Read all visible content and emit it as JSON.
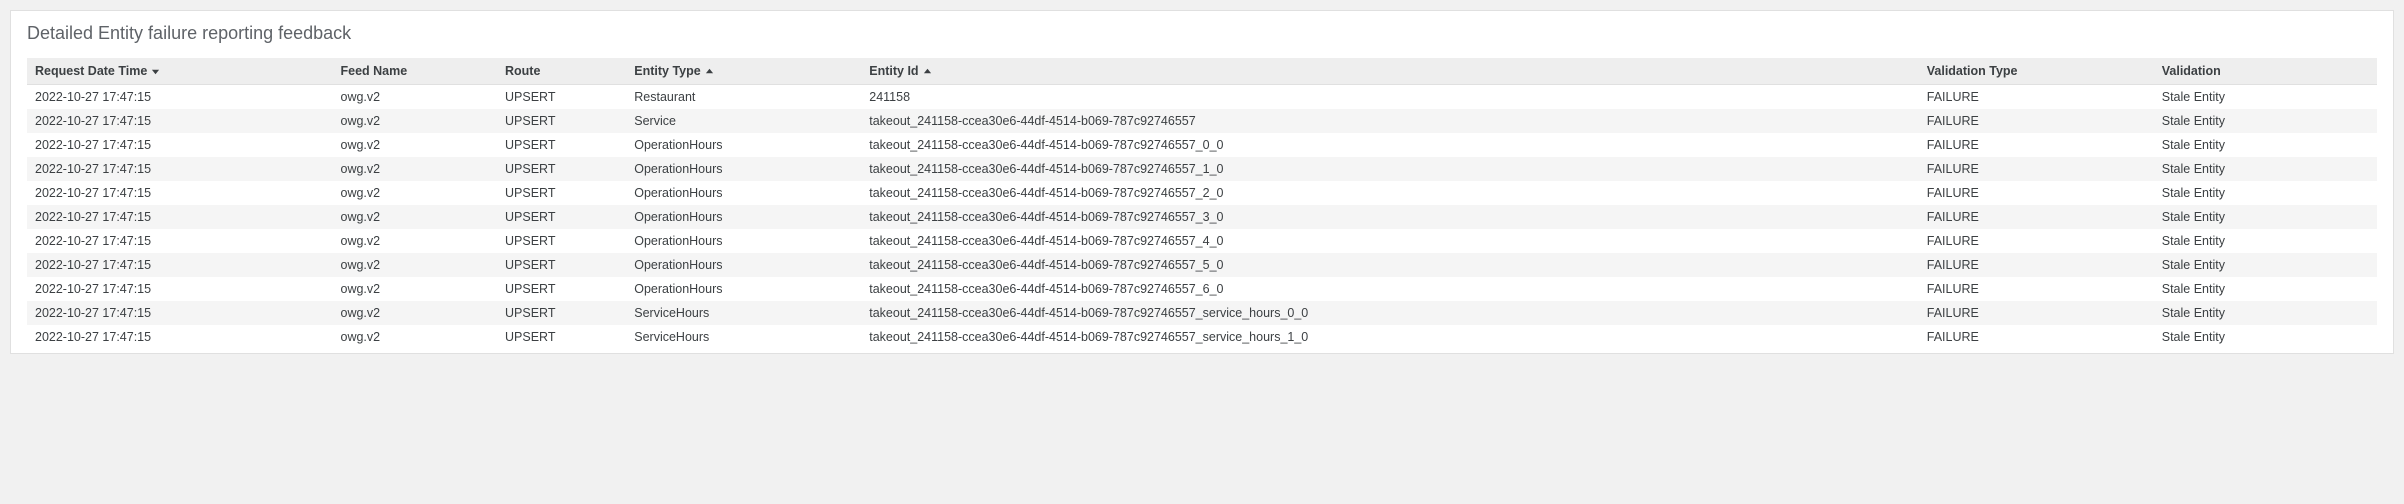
{
  "title": "Detailed Entity failure reporting feedback",
  "columns": {
    "request_date_time": "Request Date Time",
    "feed_name": "Feed Name",
    "route": "Route",
    "entity_type": "Entity Type",
    "entity_id": "Entity Id",
    "validation_type": "Validation Type",
    "validation": "Validation"
  },
  "sort": {
    "request_date_time": "desc",
    "entity_type": "asc",
    "entity_id": "asc"
  },
  "rows": [
    {
      "request_date_time": "2022-10-27 17:47:15",
      "feed_name": "owg.v2",
      "route": "UPSERT",
      "entity_type": "Restaurant",
      "entity_id": "241158",
      "validation_type": "FAILURE",
      "validation": "Stale Entity"
    },
    {
      "request_date_time": "2022-10-27 17:47:15",
      "feed_name": "owg.v2",
      "route": "UPSERT",
      "entity_type": "Service",
      "entity_id": "takeout_241158-ccea30e6-44df-4514-b069-787c92746557",
      "validation_type": "FAILURE",
      "validation": "Stale Entity"
    },
    {
      "request_date_time": "2022-10-27 17:47:15",
      "feed_name": "owg.v2",
      "route": "UPSERT",
      "entity_type": "OperationHours",
      "entity_id": "takeout_241158-ccea30e6-44df-4514-b069-787c92746557_0_0",
      "validation_type": "FAILURE",
      "validation": "Stale Entity"
    },
    {
      "request_date_time": "2022-10-27 17:47:15",
      "feed_name": "owg.v2",
      "route": "UPSERT",
      "entity_type": "OperationHours",
      "entity_id": "takeout_241158-ccea30e6-44df-4514-b069-787c92746557_1_0",
      "validation_type": "FAILURE",
      "validation": "Stale Entity"
    },
    {
      "request_date_time": "2022-10-27 17:47:15",
      "feed_name": "owg.v2",
      "route": "UPSERT",
      "entity_type": "OperationHours",
      "entity_id": "takeout_241158-ccea30e6-44df-4514-b069-787c92746557_2_0",
      "validation_type": "FAILURE",
      "validation": "Stale Entity"
    },
    {
      "request_date_time": "2022-10-27 17:47:15",
      "feed_name": "owg.v2",
      "route": "UPSERT",
      "entity_type": "OperationHours",
      "entity_id": "takeout_241158-ccea30e6-44df-4514-b069-787c92746557_3_0",
      "validation_type": "FAILURE",
      "validation": "Stale Entity"
    },
    {
      "request_date_time": "2022-10-27 17:47:15",
      "feed_name": "owg.v2",
      "route": "UPSERT",
      "entity_type": "OperationHours",
      "entity_id": "takeout_241158-ccea30e6-44df-4514-b069-787c92746557_4_0",
      "validation_type": "FAILURE",
      "validation": "Stale Entity"
    },
    {
      "request_date_time": "2022-10-27 17:47:15",
      "feed_name": "owg.v2",
      "route": "UPSERT",
      "entity_type": "OperationHours",
      "entity_id": "takeout_241158-ccea30e6-44df-4514-b069-787c92746557_5_0",
      "validation_type": "FAILURE",
      "validation": "Stale Entity"
    },
    {
      "request_date_time": "2022-10-27 17:47:15",
      "feed_name": "owg.v2",
      "route": "UPSERT",
      "entity_type": "OperationHours",
      "entity_id": "takeout_241158-ccea30e6-44df-4514-b069-787c92746557_6_0",
      "validation_type": "FAILURE",
      "validation": "Stale Entity"
    },
    {
      "request_date_time": "2022-10-27 17:47:15",
      "feed_name": "owg.v2",
      "route": "UPSERT",
      "entity_type": "ServiceHours",
      "entity_id": "takeout_241158-ccea30e6-44df-4514-b069-787c92746557_service_hours_0_0",
      "validation_type": "FAILURE",
      "validation": "Stale Entity"
    },
    {
      "request_date_time": "2022-10-27 17:47:15",
      "feed_name": "owg.v2",
      "route": "UPSERT",
      "entity_type": "ServiceHours",
      "entity_id": "takeout_241158-ccea30e6-44df-4514-b069-787c92746557_service_hours_1_0",
      "validation_type": "FAILURE",
      "validation": "Stale Entity"
    }
  ]
}
